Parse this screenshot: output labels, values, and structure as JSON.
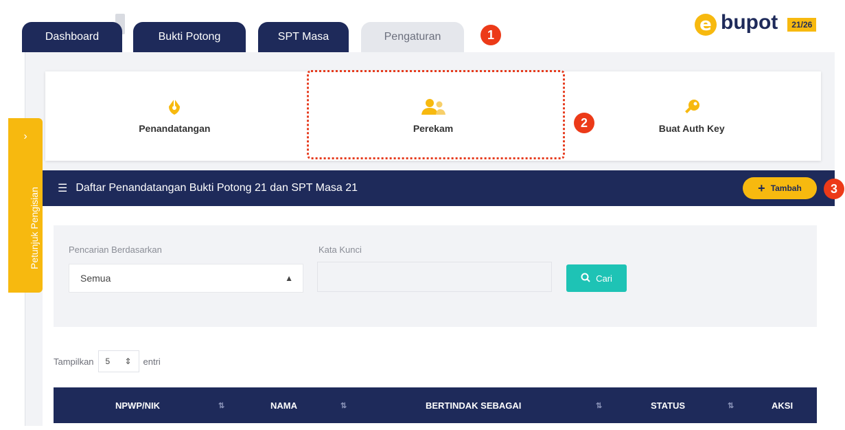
{
  "tabs": [
    {
      "label": "Dashboard",
      "state": "inactive"
    },
    {
      "label": "Bukti Potong",
      "state": "inactive"
    },
    {
      "label": "SPT Masa",
      "state": "inactive"
    },
    {
      "label": "Pengaturan",
      "state": "active"
    }
  ],
  "markers": [
    "1",
    "2",
    "3"
  ],
  "logo": {
    "mark": "e",
    "name": "bupot",
    "badge": "21/26",
    "color": "#f7b90f"
  },
  "sidebar": {
    "label": "Petunjuk Pengisian",
    "icon": "chevron-right-icon"
  },
  "cards": [
    {
      "label": "Penandatangan",
      "icon": "pen-nib-icon"
    },
    {
      "label": "Perekam",
      "icon": "users-icon",
      "highlighted": true
    },
    {
      "label": "Buat Auth Key",
      "icon": "key-icon"
    }
  ],
  "section": {
    "title": "Daftar Penandatangan Bukti Potong 21 dan SPT Masa 21",
    "add_label": "Tambah"
  },
  "search": {
    "criteria_label": "Pencarian Berdasarkan",
    "criteria_value": "Semua",
    "keyword_label": "Kata Kunci",
    "keyword_value": "",
    "button_label": "Cari"
  },
  "paging": {
    "prefix": "Tampilkan",
    "value": "5",
    "suffix": "entri"
  },
  "table": {
    "columns": [
      "NPWP/NIK",
      "NAMA",
      "BERTINDAK SEBAGAI",
      "STATUS",
      "AKSI"
    ]
  },
  "colors": {
    "navy": "#1e2a5a",
    "accent": "#f7b90f",
    "teal": "#1ec3b5",
    "marker": "#ec3a18"
  }
}
